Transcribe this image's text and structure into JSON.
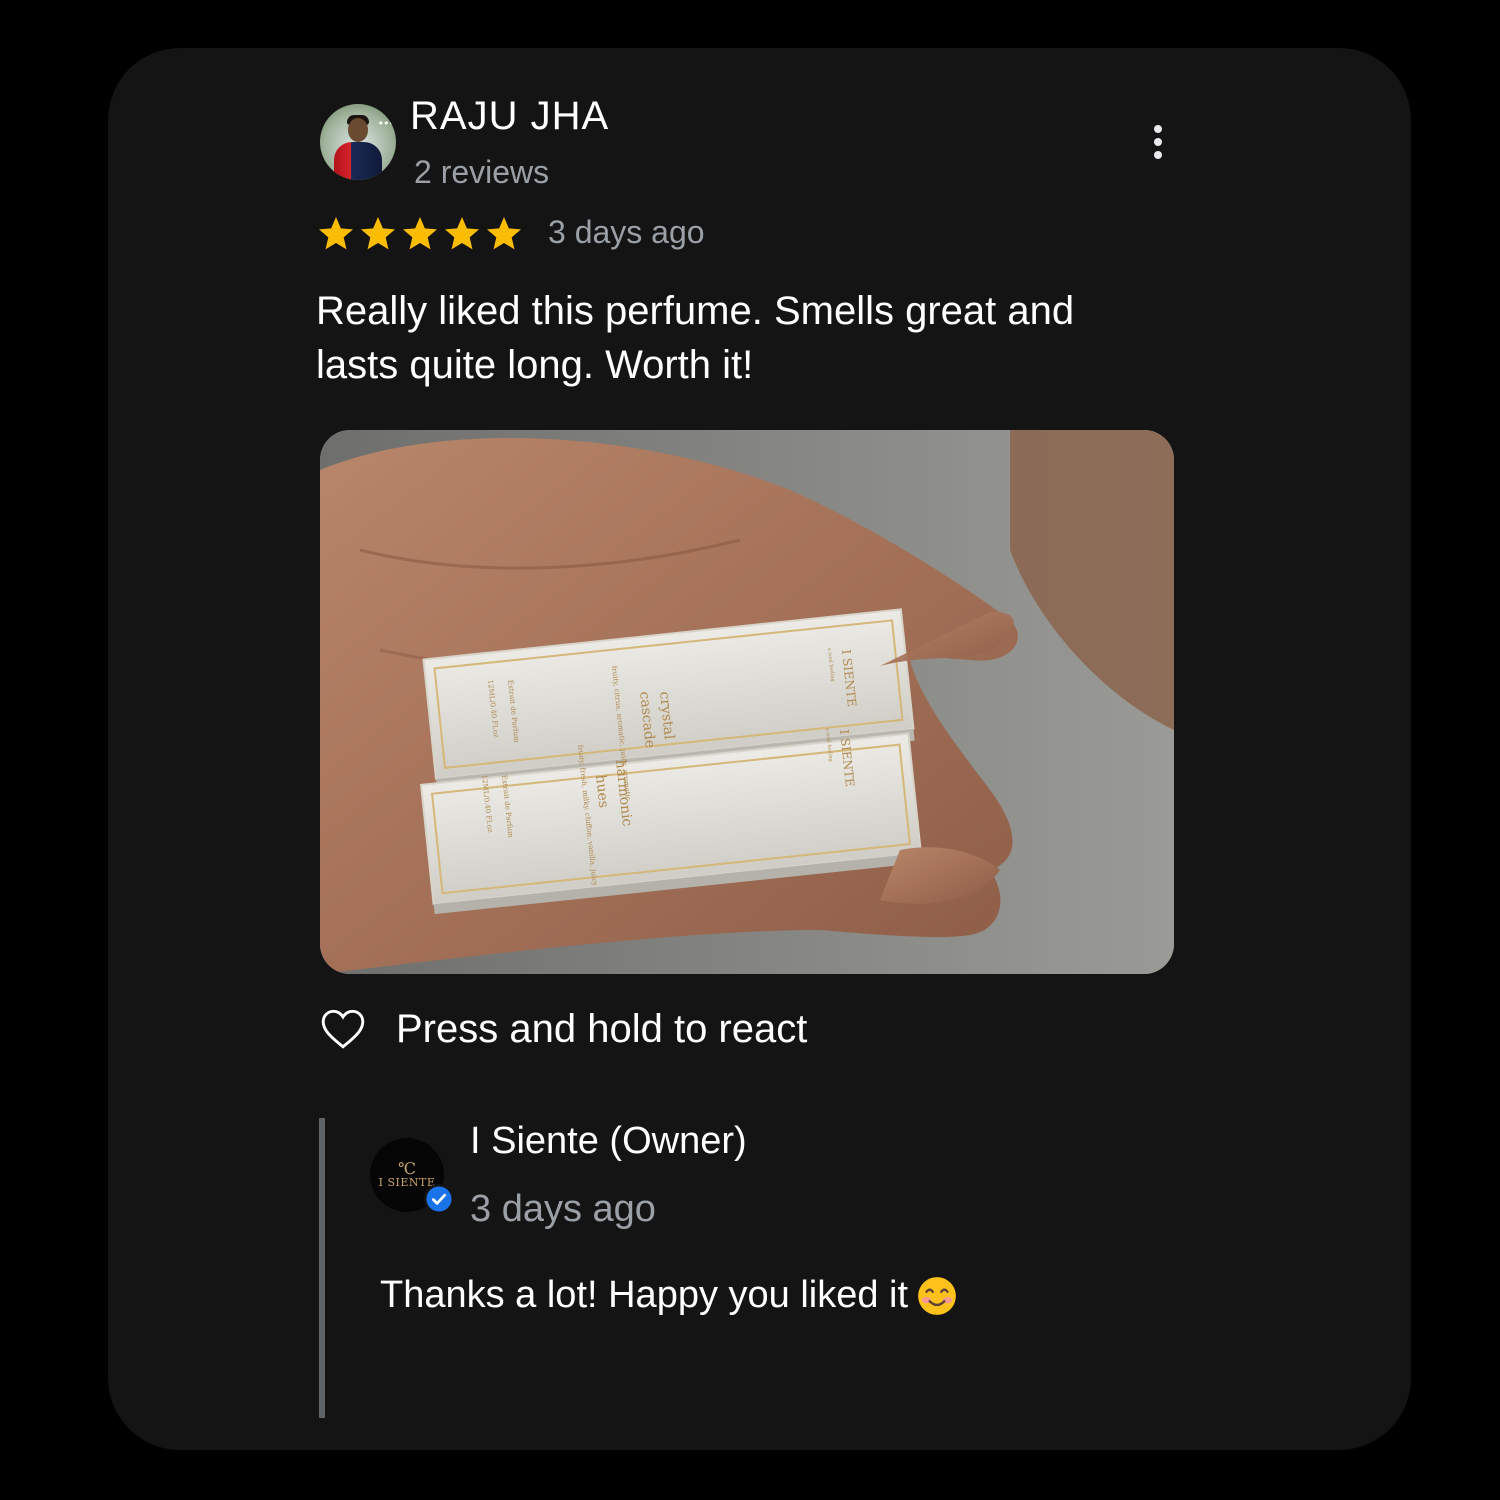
{
  "review": {
    "reviewer_name": "RAJU JHA",
    "review_count": "2 reviews",
    "rating": 5,
    "rating_max": 5,
    "date": "3 days ago",
    "text": "Really liked this perfume. Smells great and lasts quite long. Worth it!",
    "photo": {
      "box_top": {
        "brand": "I SIENTE",
        "tagline": "a soul feeling",
        "name_line1": "crystal",
        "name_line2": "cascade",
        "notes": "fruity, citrus, aromatic, juicy, aromatic",
        "type": "Extrait de Parfum",
        "volume": "12ML/0.40 Fl.oz"
      },
      "box_bottom": {
        "brand": "I SIENTE",
        "tagline": "a soul feeling",
        "name_line1": "harmonic",
        "name_line2": "hues",
        "notes": "fruity, fresh, milky, chiffon, vanilla, juicy",
        "type": "Extrait de Parfum",
        "volume": "12ML/0.40 Fl.oz"
      }
    }
  },
  "react": {
    "label": "Press and hold to react",
    "icon": "heart-outline-icon"
  },
  "reply": {
    "owner_name": "I Siente (Owner)",
    "date": "3 days ago",
    "text": "Thanks a lot! Happy you liked it",
    "logo_text": "I SIENTE",
    "logo_mark": "℃",
    "emoji": "smiling-face-emoji"
  },
  "colors": {
    "background": "#000000",
    "card": "#141414",
    "star": "#fbbc04",
    "muted_text": "#9aa0a6",
    "verified": "#1a73e8",
    "logo_gold": "#c9a46a"
  }
}
